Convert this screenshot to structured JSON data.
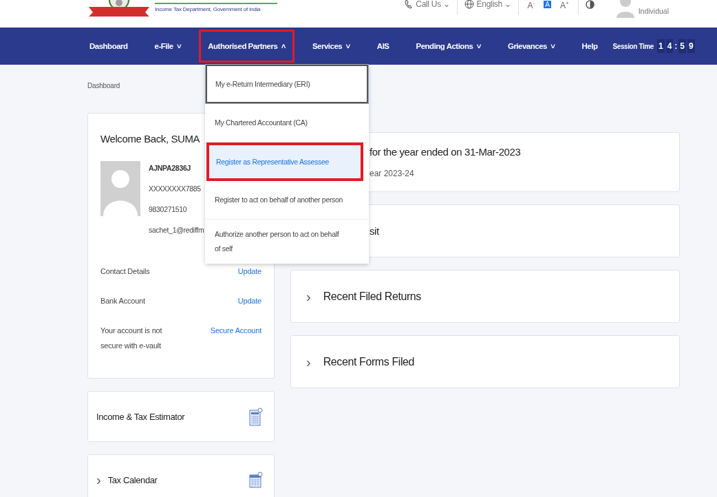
{
  "header": {
    "department": "Income Tax Department, Government of India",
    "call_us": "Call Us",
    "call_us_caret": "⌄",
    "language": "English",
    "language_caret": "⌄",
    "font_sizes": [
      {
        "label": "A",
        "sup": "-",
        "selected": false
      },
      {
        "label": "A",
        "selected": true
      },
      {
        "label": "A",
        "sup": "+",
        "selected": false
      }
    ],
    "user_role": "Individual"
  },
  "nav": {
    "items": [
      {
        "label": "Dashboard",
        "highlighted": false
      },
      {
        "label": "e-File",
        "caret": "˅",
        "highlighted": false
      },
      {
        "label": "Authorised Partners",
        "caret": "˄",
        "highlighted": true
      },
      {
        "label": "Services",
        "caret": "˅",
        "highlighted": false
      },
      {
        "label": "AIS",
        "highlighted": false
      },
      {
        "label": "Pending Actions",
        "caret": "˅",
        "highlighted": false
      },
      {
        "label": "Grievances",
        "caret": "˅",
        "highlighted": false
      },
      {
        "label": "Help",
        "highlighted": false
      }
    ],
    "session_label": "Session Time",
    "session_digits": [
      "1",
      "4",
      ":",
      "5",
      "9"
    ]
  },
  "dropdown": [
    {
      "label": "My e-Return Intermediary (ERI)",
      "focused": true,
      "selected": false,
      "highlighted": false
    },
    {
      "label": "My Chartered Accountant (CA)",
      "focused": false,
      "selected": false,
      "highlighted": false
    },
    {
      "label": "Register as Representative Assessee",
      "focused": false,
      "selected": true,
      "highlighted": true
    },
    {
      "label": "Register to act on behalf of another person",
      "focused": false,
      "selected": false,
      "highlighted": false
    },
    {
      "label": "Authorize another person to act on behalf of self",
      "focused": false,
      "selected": false,
      "highlighted": false
    }
  ],
  "breadcrumb": "Dashboard",
  "profile": {
    "welcome": "Welcome Back, SUMA",
    "pan": "AJNPA2836J",
    "aadhaar": "XXXXXXXX7885",
    "phone": "9830271510",
    "email": "sachet_1@rediffm",
    "rows": [
      {
        "label": "Contact Details",
        "action": "Update"
      },
      {
        "label": "Bank Account",
        "action": "Update"
      },
      {
        "label": "Your account is not secure with e-vault",
        "action": "Secure Account"
      }
    ]
  },
  "side_cards": [
    {
      "title": "Income & Tax Estimator"
    },
    {
      "title": "Tax Calendar",
      "chevron": "›"
    }
  ],
  "right_cards": [
    {
      "kind": "partial",
      "title": "for the year ended on 31-Mar-2023",
      "subtitle": "ear 2023-24"
    },
    {
      "kind": "partial",
      "title": "sit"
    },
    {
      "kind": "expander",
      "chevron": "›",
      "title": "Recent Filed Returns"
    },
    {
      "kind": "expander",
      "chevron": "›",
      "title": "Recent Forms Filed"
    }
  ]
}
